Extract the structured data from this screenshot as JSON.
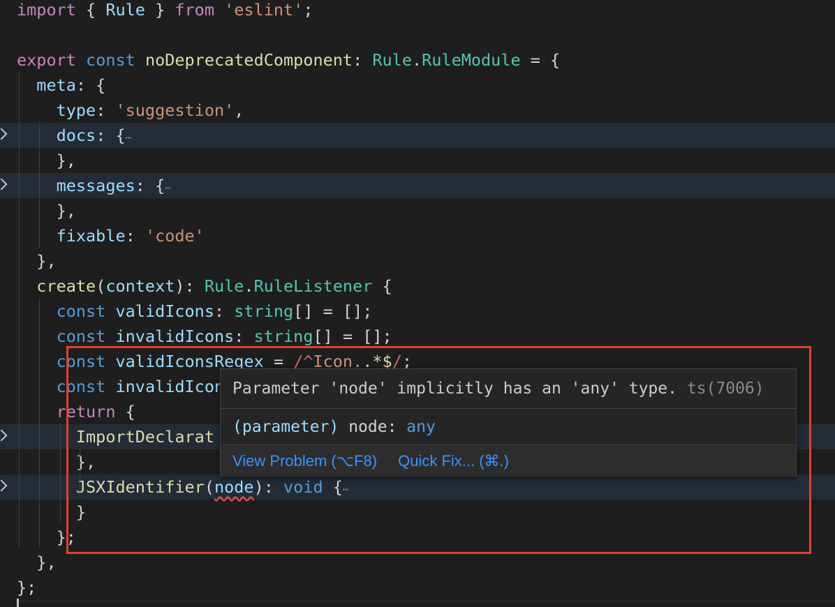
{
  "editor": {
    "lines": [
      {
        "tokens": [
          [
            "kc",
            "import"
          ],
          [
            "p",
            " { "
          ],
          [
            "v",
            "Rule"
          ],
          [
            "p",
            " } "
          ],
          [
            "kc",
            "from"
          ],
          [
            "p",
            " "
          ],
          [
            "s",
            "'eslint'"
          ],
          [
            "p",
            ";"
          ]
        ]
      },
      {
        "tokens": []
      },
      {
        "tokens": [
          [
            "kc",
            "export"
          ],
          [
            "p",
            " "
          ],
          [
            "k",
            "const"
          ],
          [
            "p",
            " "
          ],
          [
            "f",
            "noDeprecatedComponent"
          ],
          [
            "p",
            ": "
          ],
          [
            "t",
            "Rule"
          ],
          [
            "p",
            "."
          ],
          [
            "t",
            "RuleModule"
          ],
          [
            "p",
            " = {"
          ]
        ]
      },
      {
        "tokens": [
          [
            "p",
            "  "
          ],
          [
            "v",
            "meta"
          ],
          [
            "p",
            ": {"
          ]
        ]
      },
      {
        "tokens": [
          [
            "p",
            "    "
          ],
          [
            "v",
            "type"
          ],
          [
            "p",
            ": "
          ],
          [
            "s",
            "'suggestion'"
          ],
          [
            "p",
            ","
          ]
        ]
      },
      {
        "tokens": [
          [
            "p",
            "    "
          ],
          [
            "v",
            "docs"
          ],
          [
            "p",
            ": {"
          ],
          [
            "ell",
            "⋯"
          ]
        ],
        "folded": true
      },
      {
        "tokens": [
          [
            "p",
            "    },"
          ]
        ]
      },
      {
        "tokens": [
          [
            "p",
            "    "
          ],
          [
            "v",
            "messages"
          ],
          [
            "p",
            ": {"
          ],
          [
            "ell",
            "⋯"
          ]
        ],
        "folded": true
      },
      {
        "tokens": [
          [
            "p",
            "    },"
          ]
        ]
      },
      {
        "tokens": [
          [
            "p",
            "    "
          ],
          [
            "v",
            "fixable"
          ],
          [
            "p",
            ": "
          ],
          [
            "s",
            "'code'"
          ]
        ]
      },
      {
        "tokens": [
          [
            "p",
            "  },"
          ]
        ]
      },
      {
        "tokens": [
          [
            "p",
            "  "
          ],
          [
            "f",
            "create"
          ],
          [
            "p",
            "("
          ],
          [
            "v",
            "context"
          ],
          [
            "p",
            "): "
          ],
          [
            "t",
            "Rule"
          ],
          [
            "p",
            "."
          ],
          [
            "t",
            "RuleListener"
          ],
          [
            "p",
            " {"
          ]
        ]
      },
      {
        "tokens": [
          [
            "p",
            "    "
          ],
          [
            "k",
            "const"
          ],
          [
            "p",
            " "
          ],
          [
            "v",
            "validIcons"
          ],
          [
            "p",
            ": "
          ],
          [
            "t",
            "string"
          ],
          [
            "p",
            "[] = [];"
          ]
        ]
      },
      {
        "tokens": [
          [
            "p",
            "    "
          ],
          [
            "k",
            "const"
          ],
          [
            "p",
            " "
          ],
          [
            "v",
            "invalidIcons"
          ],
          [
            "p",
            ": "
          ],
          [
            "t",
            "string"
          ],
          [
            "p",
            "[] = [];"
          ]
        ]
      },
      {
        "tokens": [
          [
            "p",
            "    "
          ],
          [
            "k",
            "const"
          ],
          [
            "p",
            " "
          ],
          [
            "v",
            "validIconsRegex"
          ],
          [
            "p",
            " = "
          ],
          [
            "r",
            "/^"
          ],
          [
            "s",
            "Icon."
          ],
          [
            "rr",
            ".*$"
          ],
          [
            "r",
            "/"
          ],
          [
            "p",
            ";"
          ]
        ]
      },
      {
        "tokens": [
          [
            "p",
            "    "
          ],
          [
            "k",
            "const"
          ],
          [
            "p",
            " "
          ],
          [
            "v",
            "invalidIcons"
          ]
        ]
      },
      {
        "tokens": [
          [
            "p",
            "    "
          ],
          [
            "kc",
            "return"
          ],
          [
            "p",
            " {"
          ]
        ]
      },
      {
        "tokens": [
          [
            "p",
            "      "
          ],
          [
            "f",
            "ImportDeclarat"
          ]
        ],
        "folded": true
      },
      {
        "tokens": [
          [
            "p",
            "      },"
          ]
        ]
      },
      {
        "tokens": [
          [
            "p",
            "      "
          ],
          [
            "f",
            "JSXIdentifier"
          ],
          [
            "p",
            "("
          ],
          [
            "v sq",
            "node"
          ],
          [
            "p",
            "): "
          ],
          [
            "k",
            "void"
          ],
          [
            "p",
            " {"
          ],
          [
            "ell",
            "⋯"
          ]
        ],
        "folded": true
      },
      {
        "tokens": [
          [
            "p",
            "      }"
          ]
        ]
      },
      {
        "tokens": [
          [
            "p",
            "    };"
          ]
        ]
      },
      {
        "tokens": [
          [
            "p",
            "  },"
          ]
        ]
      },
      {
        "tokens": [
          [
            "p",
            "};"
          ]
        ]
      }
    ]
  },
  "hover": {
    "message": "Parameter 'node' implicitly has an 'any' type.",
    "code": "ts(7006)",
    "signature_prefix": "(parameter)",
    "signature_name": "node",
    "signature_colon": ":",
    "signature_type": "any",
    "view_problem_label": "View Problem (⌥F8)",
    "quick_fix_label": "Quick Fix... (⌘.)"
  },
  "colors": {
    "background": "#1e1e1e",
    "folded_line": "#232c36",
    "highlight_box": "#e0412d",
    "link": "#3794ff"
  }
}
